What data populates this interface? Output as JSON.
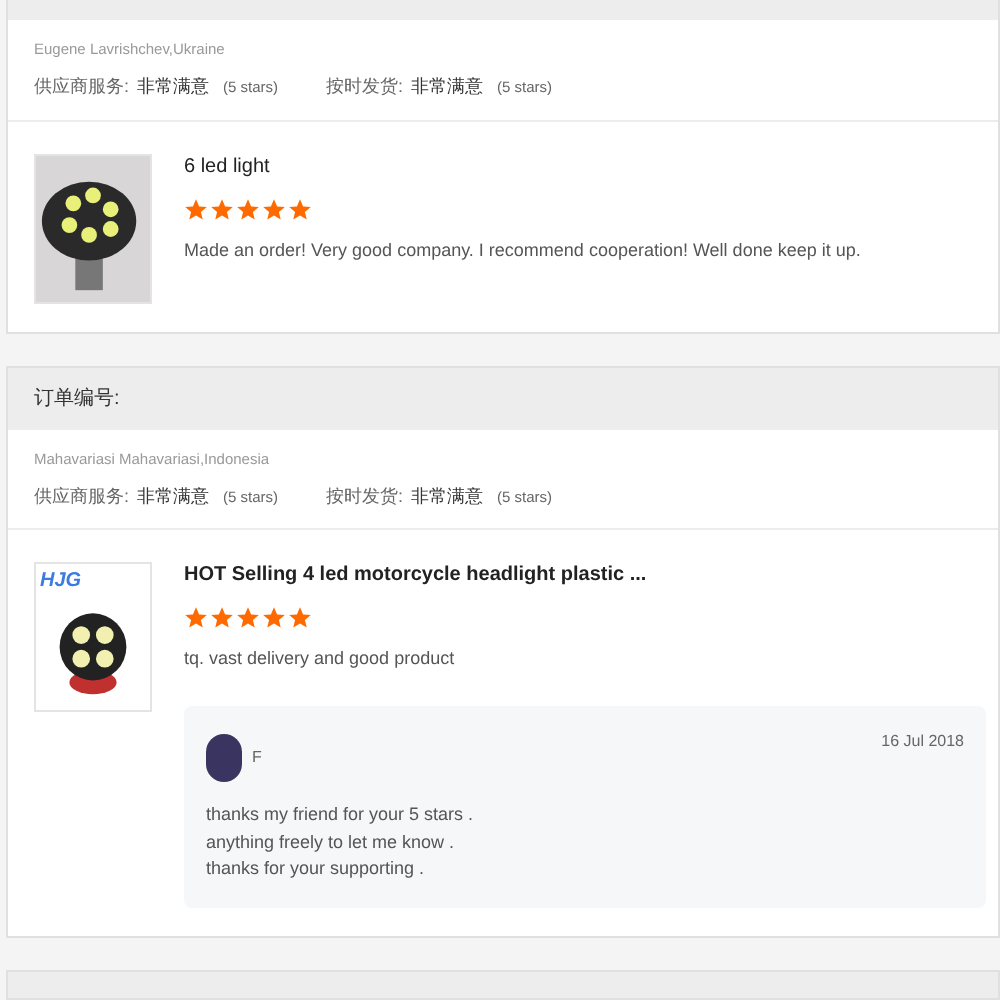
{
  "orders": [
    {
      "reviewer": "Eugene Lavrishchev,Ukraine",
      "ratings": [
        {
          "label": "供应商服务:",
          "value": "非常满意",
          "note": "(5 stars)"
        },
        {
          "label": "按时发货:",
          "value": "非常满意",
          "note": "(5 stars)"
        }
      ],
      "product": {
        "title": "6 led light",
        "stars": 5,
        "comment": "Made an order! Very good company. I recommend cooperation! Well done keep it up."
      }
    },
    {
      "order_label": "订单编号:",
      "reviewer": "Mahavariasi Mahavariasi,Indonesia",
      "ratings": [
        {
          "label": "供应商服务:",
          "value": "非常满意",
          "note": "(5 stars)"
        },
        {
          "label": "按时发货:",
          "value": "非常满意",
          "note": "(5 stars)"
        }
      ],
      "product": {
        "title": "HOT Selling 4 led motorcycle headlight plastic ...",
        "stars": 5,
        "comment": "tq. vast delivery and good product",
        "logo": "HJG"
      },
      "reply": {
        "name": "F",
        "date": "16 Jul 2018",
        "lines": [
          "thanks my friend for your 5 stars .",
          "anything freely to let me know .",
          "thanks for your supporting ."
        ]
      }
    }
  ]
}
